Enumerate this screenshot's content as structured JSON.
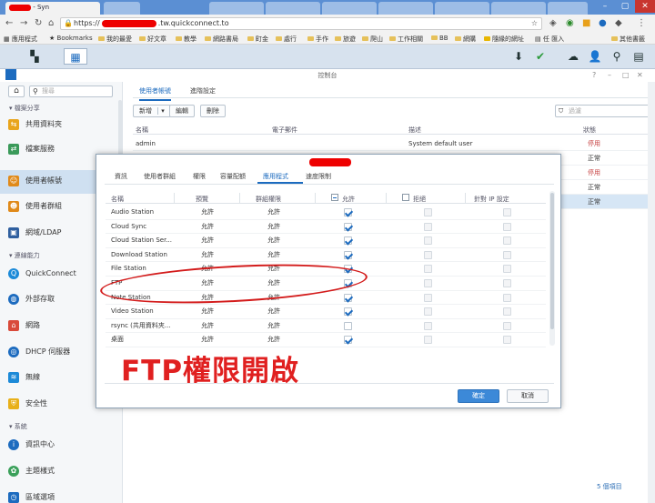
{
  "browser": {
    "tabs": [
      {
        "label": "- Syn",
        "left": 0
      },
      {
        "label": "",
        "left": 0
      }
    ],
    "url_prefix": "https://",
    "url_suffix": ".tw.quickconnect.to",
    "bookmarks": [
      "應用程式",
      "Bookmarks",
      "我的最愛",
      "好文章",
      "教學",
      "網路書局",
      "町金",
      "處行",
      "手作",
      "旅遊",
      "爬山",
      "工作相關",
      "BB",
      "網購",
      "隨緣的網址",
      "任 匯入",
      "其他書籤"
    ]
  },
  "window": {
    "title": "控制台"
  },
  "sidebar": {
    "search_placeholder": "搜尋",
    "sections": [
      {
        "title": "檔案分享"
      },
      {
        "title": "連線能力"
      },
      {
        "title": "系統"
      }
    ],
    "items": [
      {
        "label": "共用資料夾"
      },
      {
        "label": "檔案服務"
      },
      {
        "label": "使用者帳號"
      },
      {
        "label": "使用者群組"
      },
      {
        "label": "網域/LDAP"
      },
      {
        "label": "QuickConnect"
      },
      {
        "label": "外部存取"
      },
      {
        "label": "網路"
      },
      {
        "label": "DHCP 伺服器"
      },
      {
        "label": "無線"
      },
      {
        "label": "安全性"
      },
      {
        "label": "資訊中心"
      },
      {
        "label": "主題樣式"
      },
      {
        "label": "區域選項"
      }
    ]
  },
  "main": {
    "tabs": [
      "使用者帳號",
      "進階設定"
    ],
    "toolbar": {
      "create": "新增",
      "edit": "編輯",
      "delete": "刪除",
      "filter_placeholder": "過濾"
    },
    "columns": [
      "名稱",
      "電子郵件",
      "描述",
      "狀態"
    ],
    "rows": [
      {
        "name": "admin",
        "desc": "System default user",
        "status": "停用"
      },
      {
        "name": "",
        "desc": "",
        "status": "正常"
      },
      {
        "name": "",
        "desc": "",
        "status": "停用"
      },
      {
        "name": "",
        "desc": "",
        "status": "正常"
      },
      {
        "name": "",
        "desc": "",
        "status": "正常"
      }
    ],
    "footer": "5 個項目"
  },
  "dialog": {
    "tabs": [
      "資訊",
      "使用者群組",
      "權限",
      "容量配額",
      "應用程式",
      "速度限制"
    ],
    "columns": [
      "名稱",
      "預覽",
      "群組權限",
      "允許",
      "拒絕",
      "針對 IP 設定"
    ],
    "rows": [
      {
        "name": "Audio Station",
        "preview": "允許",
        "group": "允許",
        "allow": true
      },
      {
        "name": "Cloud Sync",
        "preview": "允許",
        "group": "允許",
        "allow": true
      },
      {
        "name": "Cloud Station Ser...",
        "preview": "允許",
        "group": "允許",
        "allow": true
      },
      {
        "name": "Download Station",
        "preview": "允許",
        "group": "允許",
        "allow": true
      },
      {
        "name": "File Station",
        "preview": "允許",
        "group": "允許",
        "allow": true
      },
      {
        "name": "FTP",
        "preview": "允許",
        "group": "允許",
        "allow": true
      },
      {
        "name": "Note Station",
        "preview": "允許",
        "group": "允許",
        "allow": true
      },
      {
        "name": "Video Station",
        "preview": "允許",
        "group": "允許",
        "allow": true
      },
      {
        "name": "rsync (共用資料夾...",
        "preview": "允許",
        "group": "允許",
        "allow": false
      },
      {
        "name": "桌面",
        "preview": "允許",
        "group": "允許",
        "allow": true
      }
    ],
    "ok": "確定",
    "cancel": "取消"
  },
  "annotation": {
    "text": "FTP權限開啟",
    "color": "#e02020"
  }
}
